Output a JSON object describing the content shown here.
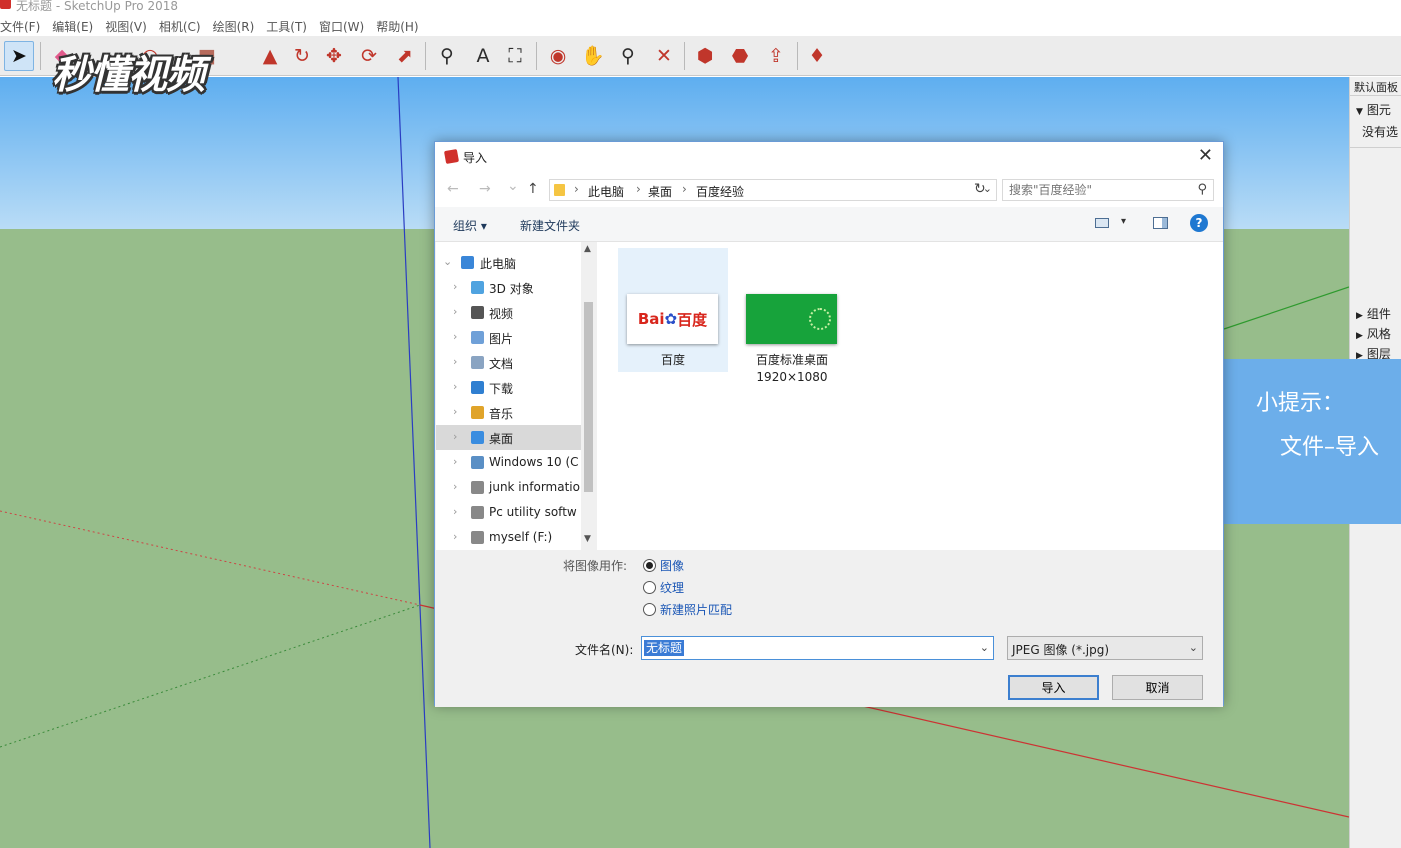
{
  "window": {
    "title": "无标题 - SketchUp Pro 2018"
  },
  "menu": [
    "文件(F)",
    "编辑(E)",
    "视图(V)",
    "相机(C)",
    "绘图(R)",
    "工具(T)",
    "窗口(W)",
    "帮助(H)"
  ],
  "toolbar": {
    "tools": [
      {
        "name": "select-tool",
        "glyph": "➤",
        "color": "#111",
        "selected": true
      },
      {
        "name": "eraser-tool",
        "glyph": "◆",
        "color": "#e25a8c"
      },
      {
        "name": "arc-tool",
        "glyph": "◠",
        "color": "#c0362b"
      },
      {
        "name": "rectangle-tool",
        "glyph": "■",
        "color": "#b76b5c"
      },
      {
        "name": "push-pull-tool",
        "glyph": "▲",
        "color": "#c0362b"
      },
      {
        "name": "rotate-tool",
        "glyph": "↻",
        "color": "#c0362b"
      },
      {
        "name": "move-tool",
        "glyph": "✥",
        "color": "#c0362b"
      },
      {
        "name": "follow-me-tool",
        "glyph": "⟳",
        "color": "#c0362b"
      },
      {
        "name": "scale-tool",
        "glyph": "⬈",
        "color": "#c0362b"
      },
      {
        "name": "tape-measure-tool",
        "glyph": "⚲",
        "color": "#2c2c2c"
      },
      {
        "name": "text-tool",
        "glyph": "A",
        "color": "#2c2c2c"
      },
      {
        "name": "paint-bucket-tool",
        "glyph": "⛶",
        "color": "#2c2c2c"
      },
      {
        "name": "orbit-tool",
        "glyph": "◉",
        "color": "#c0362b"
      },
      {
        "name": "pan-tool",
        "glyph": "✋",
        "color": "#d88a2f"
      },
      {
        "name": "zoom-tool",
        "glyph": "⚲",
        "color": "#2c2c2c"
      },
      {
        "name": "zoom-extents-tool",
        "glyph": "✕",
        "color": "#c0362b"
      },
      {
        "name": "warehouse-tool",
        "glyph": "⬢",
        "color": "#c0362b"
      },
      {
        "name": "extension-warehouse-tool",
        "glyph": "⬣",
        "color": "#c0362b"
      },
      {
        "name": "share-model-tool",
        "glyph": "⇪",
        "color": "#c0362b"
      },
      {
        "name": "ruby-tool",
        "glyph": "♦",
        "color": "#c0362b"
      }
    ]
  },
  "watermark": "秒懂视频",
  "tray": {
    "header": "默认面板",
    "entity_info": "图元",
    "no_selection": "没有选",
    "panels": [
      "组件",
      "风格",
      "图层"
    ]
  },
  "tip": {
    "title": "小提示：",
    "text": "文件–导入"
  },
  "dialog": {
    "title": "导入",
    "close": "✕",
    "nav": {
      "back": "←",
      "forward": "→",
      "recent": "⌄",
      "up": "↑"
    },
    "breadcrumb": [
      "此电脑",
      "桌面",
      "百度经验"
    ],
    "search_placeholder": "搜索\"百度经验\"",
    "organize": "组织 ▾",
    "new_folder": "新建文件夹",
    "help": "?",
    "tree": [
      {
        "label": "此电脑",
        "icon": "#3a86d8",
        "root": true
      },
      {
        "label": "3D 对象",
        "icon": "#4fa3e0"
      },
      {
        "label": "视频",
        "icon": "#555"
      },
      {
        "label": "图片",
        "icon": "#6fa0d8"
      },
      {
        "label": "文档",
        "icon": "#8aa4c2"
      },
      {
        "label": "下载",
        "icon": "#2f7fd1"
      },
      {
        "label": "音乐",
        "icon": "#e0a42a"
      },
      {
        "label": "桌面",
        "icon": "#3a8de0",
        "selected": true
      },
      {
        "label": "Windows 10 (C",
        "icon": "#5a8fc5"
      },
      {
        "label": "junk informatio",
        "icon": "#888"
      },
      {
        "label": "Pc  utility softw",
        "icon": "#888"
      },
      {
        "label": "myself (F:)",
        "icon": "#888"
      }
    ],
    "files": [
      {
        "name": "百度",
        "line2": "",
        "thumb": "baidu",
        "thumb_text_left": "Bai",
        "thumb_paw": "✿",
        "thumb_text_right": "百度",
        "selected": true
      },
      {
        "name": "百度标准桌面",
        "line2": "1920×1080",
        "thumb": "green",
        "selected": false
      }
    ],
    "use_as_label": "将图像用作:",
    "options": [
      {
        "label": "图像",
        "checked": true
      },
      {
        "label": "纹理",
        "checked": false
      },
      {
        "label": "新建照片匹配",
        "checked": false
      }
    ],
    "filename_label": "文件名(N):",
    "filename_value": "无标题",
    "file_type": "JPEG 图像 (*.jpg)",
    "import_button": "导入",
    "cancel_button": "取消"
  }
}
